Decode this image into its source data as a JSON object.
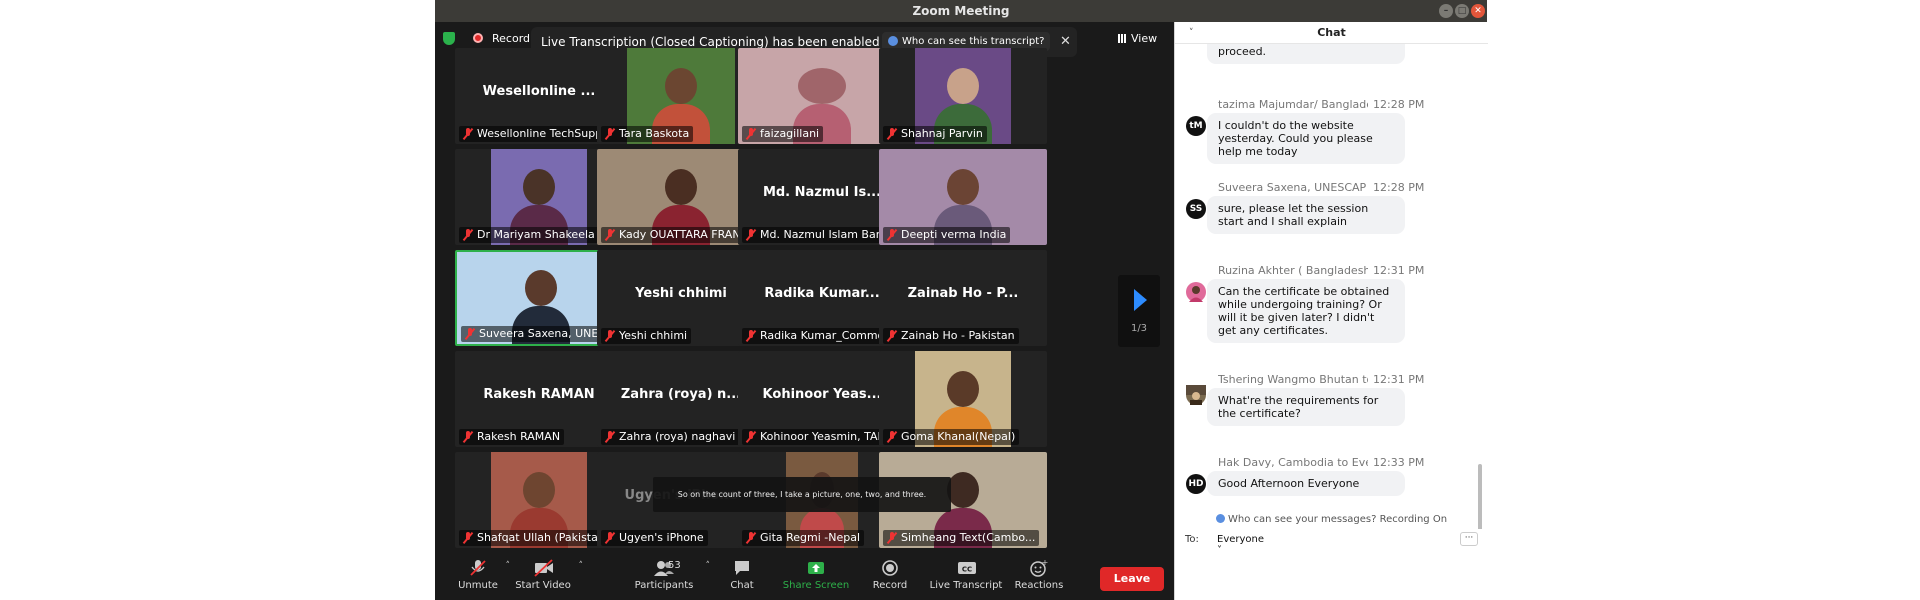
{
  "window": {
    "title": "Zoom Meeting"
  },
  "top": {
    "recording_label": "Recording",
    "notice_text": "Live Transcription (Closed Captioning) has been enabled",
    "notice_link": "Who can see this transcript?",
    "notice_close": "✕",
    "view_label": "View"
  },
  "tiles": [
    {
      "big": "Wesellonline ...",
      "name": "Wesellonline TechSupp..."
    },
    {
      "big": "",
      "name": "Tara Baskota"
    },
    {
      "big": "",
      "name": "faizagillani"
    },
    {
      "big": "",
      "name": "Shahnaj Parvin"
    },
    {
      "big": "",
      "name": "Dr Mariyam Shakeela"
    },
    {
      "big": "",
      "name": "Kady OUATTARA FRANCE"
    },
    {
      "big": "Md. Nazmul Is...",
      "name": "Md. Nazmul Islam Ban..."
    },
    {
      "big": "",
      "name": "Deepti verma India"
    },
    {
      "big": "",
      "name": "Suveera Saxena, UNESCAP"
    },
    {
      "big": "Yeshi chhimi",
      "name": "Yeshi chhimi"
    },
    {
      "big": "Radika Kumar...",
      "name": "Radika Kumar_Commo..."
    },
    {
      "big": "Zainab Ho - P...",
      "name": "Zainab Ho - Pakistan"
    },
    {
      "big": "Rakesh RAMAN",
      "name": "Rakesh RAMAN"
    },
    {
      "big": "Zahra (roya) n...",
      "name": "Zahra (roya) naghavi (I..."
    },
    {
      "big": "Kohinoor Yeas...",
      "name": "Kohinoor Yeasmin, TAR..."
    },
    {
      "big": "",
      "name": "Goma Khanal(Nepal)"
    },
    {
      "big": "",
      "name": "Shafqat Ullah (Pakistan)"
    },
    {
      "big": "Ugyen's iPhone",
      "name": "Ugyen's iPhone"
    },
    {
      "big": "",
      "name": "Gita Regmi -Nepal"
    },
    {
      "big": "",
      "name": "Simheang Text(Cambo..."
    }
  ],
  "pager": {
    "indicator": "1/3"
  },
  "caption": "So on the count of three, I take a picture, one, two, and three.",
  "toolbar": {
    "unmute": "Unmute",
    "start_video": "Start Video",
    "participants": "Participants",
    "participants_count": "53",
    "chat": "Chat",
    "share_screen": "Share Screen",
    "record": "Record",
    "live_transcript": "Live Transcript",
    "reactions": "Reactions",
    "leave": "Leave"
  },
  "chat": {
    "title": "Chat",
    "first_fragment": "proceed.",
    "messages": [
      {
        "initials": "tM",
        "sender": "tazima Majumdar/ Banglade...",
        "time": "12:28 PM",
        "text": "I couldn't do the website yesterday. Could you please help me today"
      },
      {
        "initials": "SS",
        "sender": "Suveera Saxena, UNESCAP t...",
        "time": "12:28 PM",
        "text": "sure, please let the session start and I shall explain"
      },
      {
        "initials": "",
        "sender": "Ruzina Akhter ( Bangladesh)...",
        "time": "12:31 PM",
        "text": "Can the certificate be obtained while undergoing training? Or will it be given later? I didn't get any certificates."
      },
      {
        "initials": "",
        "sender": "Tshering Wangmo Bhutan to...",
        "time": "12:31 PM",
        "text": "What're the requirements for the certificate?"
      },
      {
        "initials": "HD",
        "sender": "Hak Davy, Cambodia to Ever...",
        "time": "12:33 PM",
        "text": "Good Afternoon Everyone"
      }
    ],
    "who_can_see": "Who can see your messages? Recording On",
    "to_label": "To:",
    "to_value": "Everyone",
    "more": "···"
  },
  "colors": {
    "accent_blue": "#2d8cff",
    "leave_red": "#e02828",
    "active_speaker_green": "#2eb04a",
    "share_green": "#2eb04a"
  }
}
